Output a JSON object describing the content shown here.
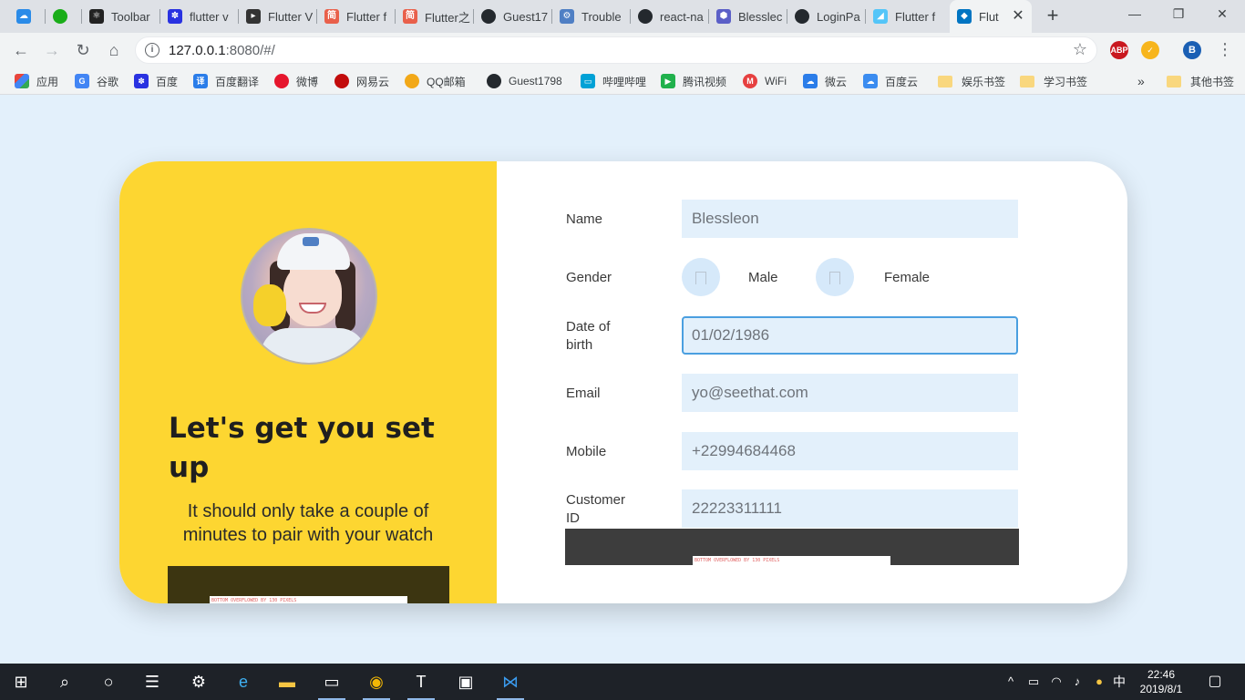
{
  "browser": {
    "tabs": [
      {
        "title": "",
        "icon": "cloud-icon",
        "color": "#2a8be8"
      },
      {
        "title": "",
        "icon": "wechat-icon",
        "color": "#1aad19"
      },
      {
        "title": "Toolbar",
        "icon": "react-icon",
        "color": "#222222"
      },
      {
        "title": "flutter v",
        "icon": "baidu-paw-icon",
        "color": "#2932e1"
      },
      {
        "title": "Flutter V",
        "icon": "play-box-icon",
        "color": "#333333"
      },
      {
        "title": "Flutter f",
        "icon": "jianshu-icon",
        "color": "#e9604b"
      },
      {
        "title": "Flutter之",
        "icon": "jianshu-icon",
        "color": "#e9604b"
      },
      {
        "title": "Guest17",
        "icon": "github-icon",
        "color": "#24292e"
      },
      {
        "title": "Trouble",
        "icon": "react-gear-icon",
        "color": "#4f7fc4"
      },
      {
        "title": "react-na",
        "icon": "github-icon",
        "color": "#24292e"
      },
      {
        "title": "Blesslec",
        "icon": "hexagon-icon",
        "color": "#5b5fc7"
      },
      {
        "title": "LoginPa",
        "icon": "github-icon",
        "color": "#24292e"
      },
      {
        "title": "Flutter f",
        "icon": "flutter-icon",
        "color": "#54c5f8"
      },
      {
        "title": "Flut",
        "icon": "dart-icon",
        "color": "#0175c2"
      }
    ],
    "url_host": "127.0.0.1",
    "url_rest": ":8080/#/",
    "extensions": [
      {
        "label": "ABP",
        "icon": "adblock-icon",
        "color": "#c9181f"
      },
      {
        "label": "",
        "icon": "sync-check-icon",
        "color": "#f7b51c"
      },
      {
        "label": "B",
        "icon": "profile-avatar-icon",
        "color": "#1a5fb4"
      }
    ],
    "bookmarks": [
      {
        "label": "应用",
        "icon": "apps-grid-icon",
        "color": "#e8453c"
      },
      {
        "label": "谷歌",
        "icon": "google-icon",
        "color": "#4285f4"
      },
      {
        "label": "百度",
        "icon": "baidu-paw-icon",
        "color": "#2932e1"
      },
      {
        "label": "百度翻译",
        "icon": "translate-icon",
        "color": "#2b7de9"
      },
      {
        "label": "微博",
        "icon": "weibo-icon",
        "color": "#e6162d"
      },
      {
        "label": "网易云",
        "icon": "netease-music-icon",
        "color": "#c20c0c"
      },
      {
        "label": "QQ邮箱",
        "icon": "qqmail-icon",
        "color": "#f2a818"
      },
      {
        "label": "Guest1798",
        "icon": "github-icon",
        "color": "#24292e"
      },
      {
        "label": "哔哩哔哩",
        "icon": "bilibili-icon",
        "color": "#00a1d6"
      },
      {
        "label": "腾讯视频",
        "icon": "tencent-video-icon",
        "color": "#20b14c"
      },
      {
        "label": "WiFi",
        "icon": "wifi-m-icon",
        "color": "#e64040"
      },
      {
        "label": "微云",
        "icon": "weiyun-icon",
        "color": "#2b7de9"
      },
      {
        "label": "百度云",
        "icon": "baidu-cloud-icon",
        "color": "#3b8cf0"
      },
      {
        "label": "娱乐书签",
        "icon": "folder-icon",
        "color": "#f9d77e"
      },
      {
        "label": "学习书签",
        "icon": "folder-icon",
        "color": "#f9d77e"
      },
      {
        "label": "其他书签",
        "icon": "folder-icon",
        "color": "#f9d77e"
      }
    ],
    "bookmarks_more": "»"
  },
  "page": {
    "headline": "Let's get you set up",
    "subline": "It should only take a couple of minutes to pair with your watch",
    "overflow_text": "BOTTOM OVERFLOWED BY 130 PIXELS",
    "accent": "#fdd631",
    "field_bg": "#e3f0fb",
    "form": {
      "name_label": "Name",
      "name_value": "Blessleon",
      "gender_label": "Gender",
      "gender_male": "Male",
      "gender_female": "Female",
      "dob_label": "Date of birth",
      "dob_value": "01/02/1986",
      "email_label": "Email",
      "email_value": "yo@seethat.com",
      "mobile_label": "Mobile",
      "mobile_value": "+22994684468",
      "customer_label": "Customer ID",
      "customer_value": "22223311111"
    }
  },
  "taskbar": {
    "items": [
      {
        "icon": "windows-start-icon"
      },
      {
        "icon": "search-icon"
      },
      {
        "icon": "cortana-icon"
      },
      {
        "icon": "task-view-icon"
      },
      {
        "icon": "settings-gear-icon"
      },
      {
        "icon": "edge-icon"
      },
      {
        "icon": "file-explorer-icon"
      },
      {
        "icon": "terminal-icon"
      },
      {
        "icon": "chrome-icon"
      },
      {
        "icon": "typora-icon"
      },
      {
        "icon": "photos-icon"
      },
      {
        "icon": "vscode-icon"
      }
    ],
    "ime": "中",
    "time": "22:46",
    "date": "2019/8/1"
  }
}
